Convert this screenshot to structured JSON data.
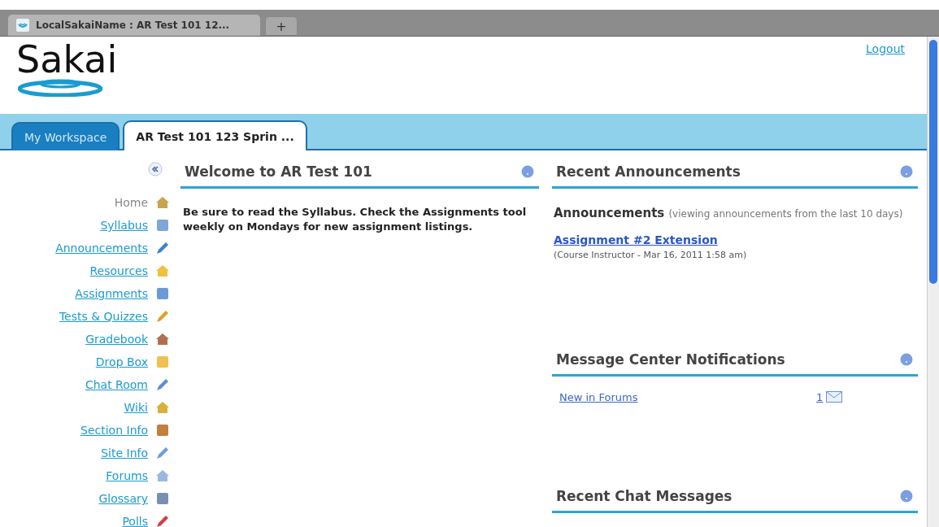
{
  "browser": {
    "tab_title": "LocalSakaiName : AR Test 101 12...",
    "new_tab": "+"
  },
  "header": {
    "logo": "Sakai",
    "logout": "Logout"
  },
  "site_tabs": [
    {
      "label": "My Workspace",
      "selected": false
    },
    {
      "label": "AR Test 101 123 Sprin ...",
      "selected": true
    }
  ],
  "tool_menu": [
    {
      "label": "Home",
      "selected": true
    },
    {
      "label": "Syllabus",
      "selected": false
    },
    {
      "label": "Announcements",
      "selected": false
    },
    {
      "label": "Resources",
      "selected": false
    },
    {
      "label": "Assignments",
      "selected": false
    },
    {
      "label": "Tests & Quizzes",
      "selected": false
    },
    {
      "label": "Gradebook",
      "selected": false
    },
    {
      "label": "Drop Box",
      "selected": false
    },
    {
      "label": "Chat Room",
      "selected": false
    },
    {
      "label": "Wiki",
      "selected": false
    },
    {
      "label": "Section Info",
      "selected": false
    },
    {
      "label": "Site Info",
      "selected": false
    },
    {
      "label": "Forums",
      "selected": false
    },
    {
      "label": "Glossary",
      "selected": false
    },
    {
      "label": "Polls",
      "selected": false
    }
  ],
  "welcome": {
    "title": "Welcome to AR Test 101",
    "body": "Be sure to read the Syllabus. Check the Assignments tool weekly on Mondays for new assignment listings."
  },
  "announcements": {
    "title": "Recent Announcements",
    "heading": "Announcements",
    "note": "(viewing announcements from the last 10 days)",
    "items": [
      {
        "title": "Assignment #2 Extension",
        "meta": "(Course Instructor - Mar 16, 2011 1:58 am)"
      }
    ]
  },
  "messages": {
    "title": "Message Center Notifications",
    "rows": [
      {
        "label": "New in Forums",
        "count": "1"
      }
    ]
  },
  "chat": {
    "title": "Recent Chat Messages"
  }
}
